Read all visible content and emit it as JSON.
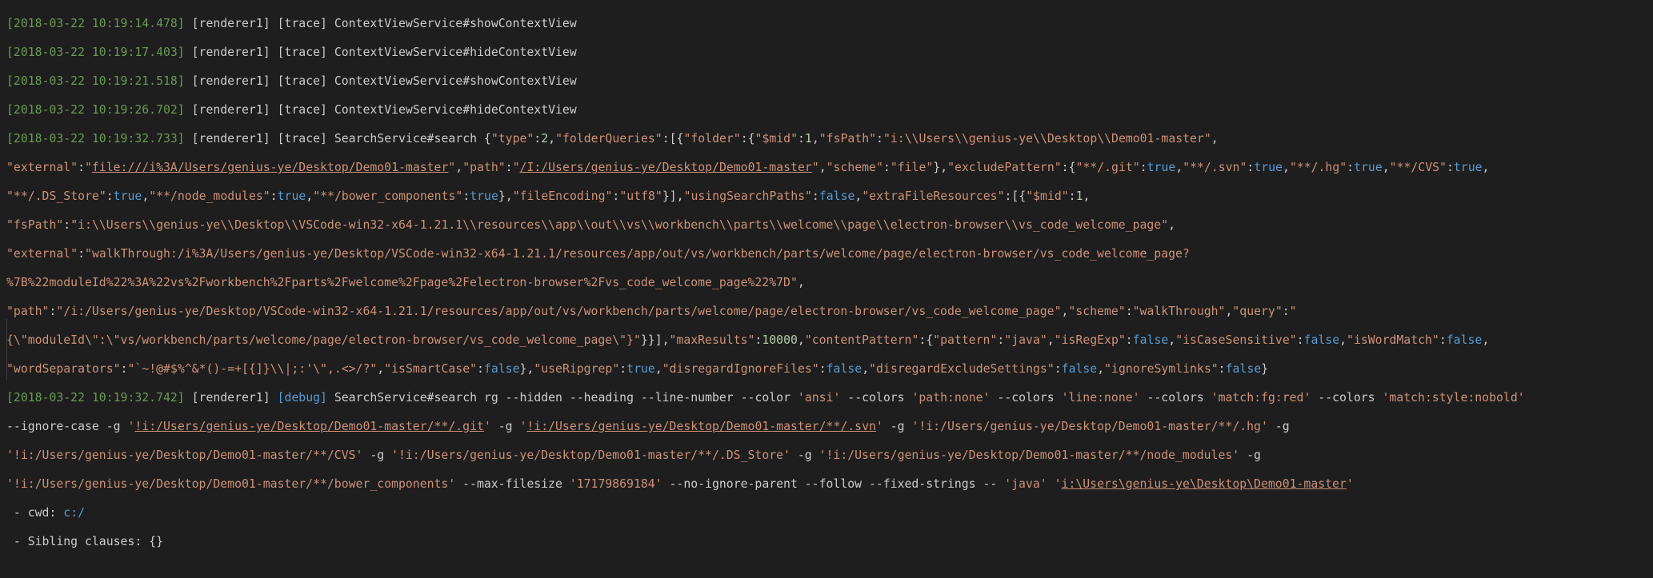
{
  "log": [
    {
      "ts": "[2018-03-22 10:19:14.478]",
      "src": "[renderer1]",
      "level": "[trace]",
      "msg": "ContextViewService#showContextView"
    },
    {
      "ts": "[2018-03-22 10:19:17.403]",
      "src": "[renderer1]",
      "level": "[trace]",
      "msg": "ContextViewService#hideContextView"
    },
    {
      "ts": "[2018-03-22 10:19:21.518]",
      "src": "[renderer1]",
      "level": "[trace]",
      "msg": "ContextViewService#showContextView"
    },
    {
      "ts": "[2018-03-22 10:19:26.702]",
      "src": "[renderer1]",
      "level": "[trace]",
      "msg": "ContextViewService#hideContextView"
    }
  ],
  "search": {
    "ts": "[2018-03-22 10:19:32.733]",
    "src": "[renderer1]",
    "level": "[trace]",
    "msg": "SearchService#search",
    "type": "2",
    "mid1": "1",
    "fsPath1": "i:\\\\Users\\\\genius-ye\\\\Desktop\\\\Demo01-master",
    "external1": "file:///i%3A/Users/genius-ye/Desktop/Demo01-master",
    "path1": "/I:/Users/genius-ye/Desktop/Demo01-master",
    "scheme1": "file",
    "ex_git": "**/.git",
    "ex_svn": "**/.svn",
    "ex_hg": "**/.hg",
    "ex_cvs": "**/CVS",
    "ex_ds": "**/.DS_Store",
    "ex_nm": "**/node_modules",
    "ex_bc": "**/bower_components",
    "fileEncoding": "utf8",
    "usingSearchPaths": "false",
    "mid2": "1",
    "fsPath2": "i:\\\\Users\\\\genius-ye\\\\Desktop\\\\VSCode-win32-x64-1.21.1\\\\resources\\\\app\\\\out\\\\vs\\\\workbench\\\\parts\\\\welcome\\\\page\\\\electron-browser\\\\vs_code_welcome_page",
    "external2a": "walkThrough:/i%3A/Users/genius-ye/Desktop/VSCode-win32-x64-1.21.1/resources/app/out/vs/workbench/parts/welcome/page/electron-browser/vs_code_welcome_page?",
    "external2b": "%7B%22moduleId%22%3A%22vs%2Fworkbench%2Fparts%2Fwelcome%2Fpage%2Felectron-browser%2Fvs_code_welcome_page%22%7D",
    "path2": "/i:/Users/genius-ye/Desktop/VSCode-win32-x64-1.21.1/resources/app/out/vs/workbench/parts/welcome/page/electron-browser/vs_code_welcome_page",
    "scheme2": "walkThrough",
    "query2": "{\\\"moduleId\\\":\\\"vs/workbench/parts/welcome/page/electron-browser/vs_code_welcome_page\\\"}",
    "maxResults": "10000",
    "pattern": "java",
    "isRegExp": "false",
    "isCaseSensitive": "false",
    "isWordMatch": "false",
    "wordSeparators": "`~!@#$%^&*()-=+[{]}\\\\|;:'\\\",.<>/?",
    "isSmartCase": "false",
    "useRipgrep": "true",
    "disregardIgnoreFiles": "false",
    "disregardExcludeSettings": "false",
    "ignoreSymlinks": "false"
  },
  "rg": {
    "ts": "[2018-03-22 10:19:32.742]",
    "src": "[renderer1]",
    "level": "[debug]",
    "msg": "SearchService#search rg --hidden --heading --line-number --color",
    "color": "'ansi'",
    "c1": "'path:none'",
    "c2": "'line:none'",
    "c3": "'match:fg:red'",
    "c4": "'match:style:nobold'",
    "g1": "!i:/Users/genius-ye/Desktop/Demo01-master/**/.git",
    "g2": "!i:/Users/genius-ye/Desktop/Demo01-master/**/.svn",
    "g3": "'!i:/Users/genius-ye/Desktop/Demo01-master/**/.hg'",
    "g4": "'!i:/Users/genius-ye/Desktop/Demo01-master/**/CVS'",
    "g5": "'!i:/Users/genius-ye/Desktop/Demo01-master/**/.DS_Store'",
    "g6": "'!i:/Users/genius-ye/Desktop/Demo01-master/**/node_modules'",
    "g7": "'!i:/Users/genius-ye/Desktop/Demo01-master/**/bower_components'",
    "filesize": "'17179869184'",
    "mid": "--no-ignore-parent --follow --fixed-strings --",
    "java": "'java'",
    "dir": "i:\\Users\\genius-ye\\Desktop\\Demo01-master",
    "cwd_label": " - cwd: ",
    "cwd": "c:/",
    "sibling": " - Sibling clauses: {}"
  }
}
